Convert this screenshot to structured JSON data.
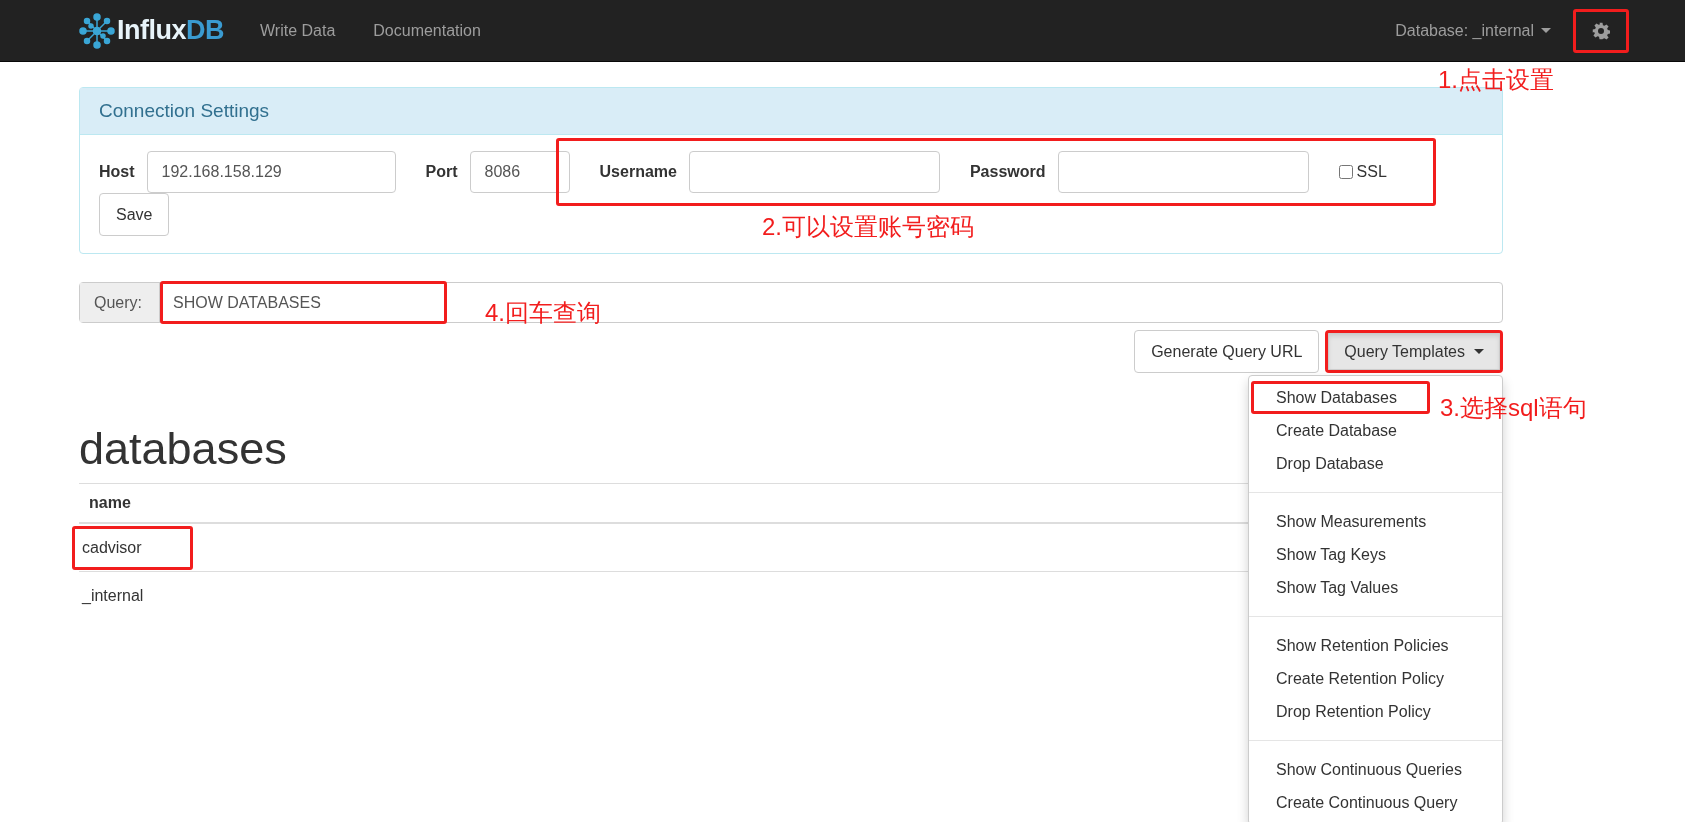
{
  "navbar": {
    "brand_parts": [
      "Influx",
      "DB"
    ],
    "links": [
      "Write Data",
      "Documentation"
    ],
    "database": {
      "label": "Database: _internal"
    },
    "settings": {
      "highlighted": true
    }
  },
  "connection": {
    "title": "Connection Settings",
    "host": {
      "label": "Host",
      "value": "192.168.158.129"
    },
    "port": {
      "label": "Port",
      "value": "8086"
    },
    "credentials_highlighted": true,
    "username": {
      "label": "Username"
    },
    "password": {
      "label": "Password"
    },
    "ssl": {
      "label": "SSL",
      "checked": false
    },
    "save": "Save"
  },
  "query": {
    "label": "Query:",
    "value": "SHOW DATABASES",
    "highlighted": true
  },
  "buttons": {
    "generate": "Generate Query URL",
    "templates": {
      "label": "Query Templates",
      "highlighted": true,
      "expanded": true
    }
  },
  "templates_menu": [
    [
      {
        "label": "Show Databases",
        "highlighted": true
      },
      {
        "label": "Create Database",
        "highlighted": false
      },
      {
        "label": "Drop Database",
        "highlighted": false
      }
    ],
    [
      {
        "label": "Show Measurements",
        "highlighted": false
      },
      {
        "label": "Show Tag Keys",
        "highlighted": false
      },
      {
        "label": "Show Tag Values",
        "highlighted": false
      }
    ],
    [
      {
        "label": "Show Retention Policies",
        "highlighted": false
      },
      {
        "label": "Create Retention Policy",
        "highlighted": false
      },
      {
        "label": "Drop Retention Policy",
        "highlighted": false
      }
    ],
    [
      {
        "label": "Show Continuous Queries",
        "highlighted": false
      },
      {
        "label": "Create Continuous Query",
        "highlighted": false
      }
    ]
  ],
  "result": {
    "title": "databases",
    "columns": [
      "name"
    ],
    "rows": [
      {
        "cells": [
          "cadvisor"
        ],
        "highlighted": true
      },
      {
        "cells": [
          "_internal"
        ],
        "highlighted": false
      }
    ]
  },
  "annotations": [
    {
      "kind": "settings",
      "text": "1.点击设置"
    },
    {
      "kind": "credentials",
      "text": "2.可以设置账号密码"
    },
    {
      "kind": "templates",
      "text": "3.选择sql语句"
    },
    {
      "kind": "query",
      "text": "4.回车查询"
    }
  ]
}
